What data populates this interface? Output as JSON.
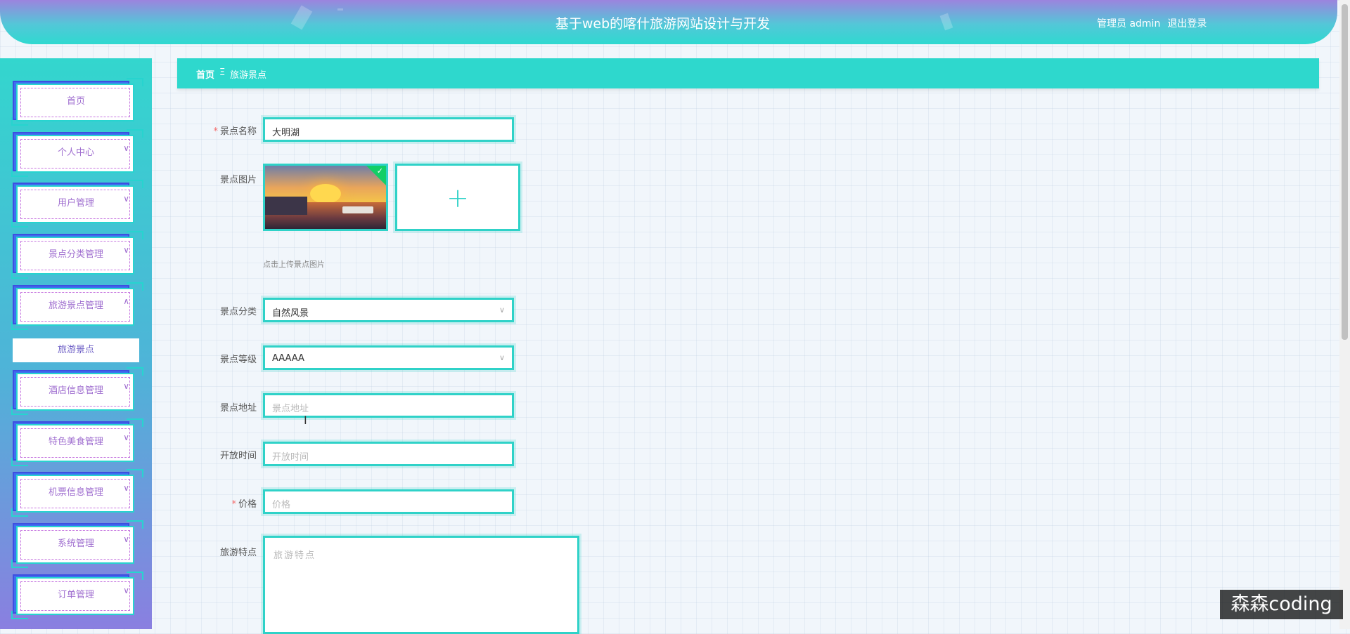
{
  "header": {
    "title": "基于web的喀什旅游网站设计与开发",
    "user_label": "管理员 admin",
    "logout_label": "退出登录"
  },
  "sidebar": {
    "items": [
      {
        "label": "首页",
        "has_arrow": false
      },
      {
        "label": "个人中心",
        "has_arrow": true,
        "arrow": "∨"
      },
      {
        "label": "用户管理",
        "has_arrow": true,
        "arrow": "∨"
      },
      {
        "label": "景点分类管理",
        "has_arrow": true,
        "arrow": "∨"
      },
      {
        "label": "旅游景点管理",
        "has_arrow": true,
        "arrow": "∧"
      },
      {
        "label": "酒店信息管理",
        "has_arrow": true,
        "arrow": "∨"
      },
      {
        "label": "特色美食管理",
        "has_arrow": true,
        "arrow": "∨"
      },
      {
        "label": "机票信息管理",
        "has_arrow": true,
        "arrow": "∨"
      },
      {
        "label": "系统管理",
        "has_arrow": true,
        "arrow": "∨"
      },
      {
        "label": "订单管理",
        "has_arrow": true,
        "arrow": "∨"
      }
    ],
    "active_submenu": "旅游景点"
  },
  "breadcrumb": {
    "home": "首页",
    "separator": "Ξ",
    "current": "旅游景点"
  },
  "form": {
    "name": {
      "label": "景点名称",
      "required": "*",
      "value": "大明湖"
    },
    "image": {
      "label": "景点图片",
      "upload_tip": "点击上传景点图片",
      "plus": "+"
    },
    "category": {
      "label": "景点分类",
      "value": "自然风景"
    },
    "level": {
      "label": "景点等级",
      "value": "AAAAA"
    },
    "address": {
      "label": "景点地址",
      "placeholder": "景点地址"
    },
    "open_time": {
      "label": "开放时间",
      "placeholder": "开放时间"
    },
    "price": {
      "label": "价格",
      "required": "*",
      "placeholder": "价格"
    },
    "features": {
      "label": "旅游特点",
      "placeholder": "旅游特点"
    }
  },
  "watermark": "森森coding",
  "colors": {
    "accent": "#2fd2c8",
    "menu_text": "#a06fd0",
    "required": "#f56c6c"
  }
}
